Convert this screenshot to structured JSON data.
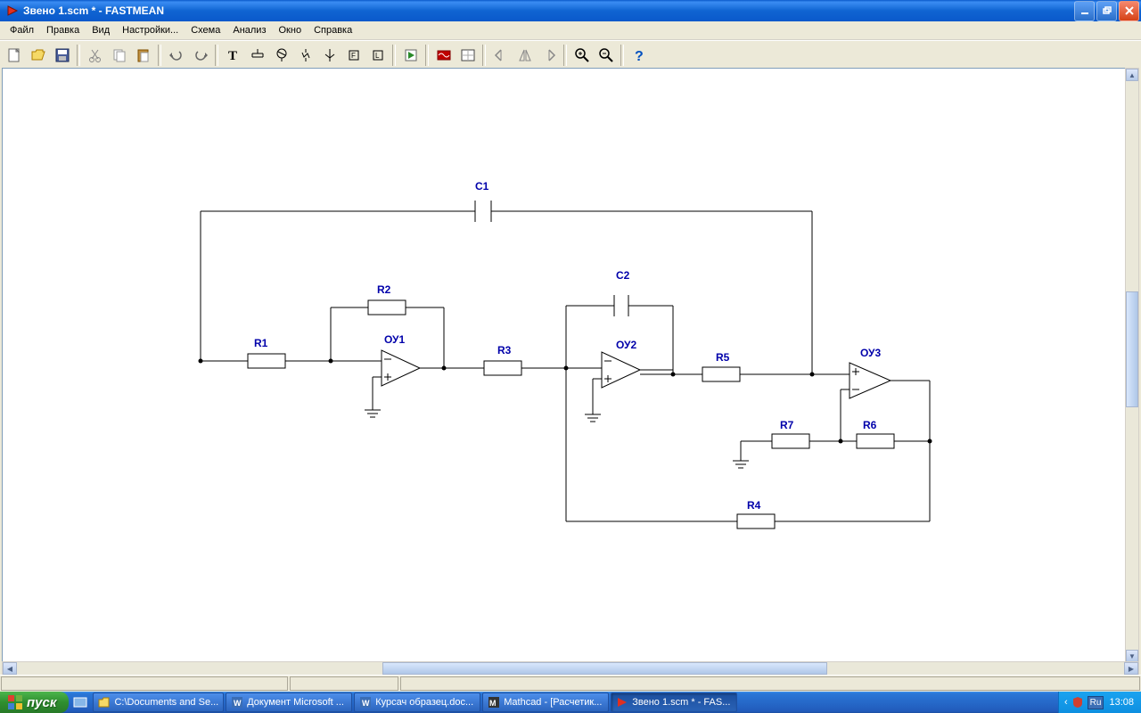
{
  "window": {
    "title": "Звено 1.scm * - FASTMEAN"
  },
  "menu": {
    "file": "Файл",
    "edit": "Правка",
    "view": "Вид",
    "settings": "Настройки...",
    "scheme": "Схема",
    "analysis": "Анализ",
    "window": "Окно",
    "help": "Справка"
  },
  "toolbar_tips": {
    "new": "new",
    "open": "open",
    "save": "save",
    "cut": "cut",
    "copy": "copy",
    "paste": "paste",
    "undo": "undo",
    "redo": "redo",
    "text": "text",
    "ground": "ground",
    "resistor": "resistor",
    "capacitor": "capacitor",
    "inductor": "inductor",
    "source": "source",
    "element": "element",
    "run": "run",
    "osc": "osc",
    "plot": "plot",
    "rotl": "rotate-left",
    "rotr": "rotate-right",
    "mir": "mirror",
    "zin": "zoom-in",
    "zout": "zoom-out",
    "about": "help"
  },
  "schematic": {
    "C1": "C1",
    "C2": "C2",
    "R1": "R1",
    "R2": "R2",
    "R3": "R3",
    "R4": "R4",
    "R5": "R5",
    "R6": "R6",
    "R7": "R7",
    "OY1": "ОУ1",
    "OY2": "ОУ2",
    "OY3": "ОУ3"
  },
  "taskbar": {
    "start": "пуск",
    "t1": "C:\\Documents and Se...",
    "t2": "Документ Microsoft ...",
    "t3": "Курсач образец.doc...",
    "t4": "Mathcad - [Расчетик...",
    "t5": "Звено 1.scm * - FAS...",
    "lang": "Ru",
    "clock": "13:08"
  }
}
